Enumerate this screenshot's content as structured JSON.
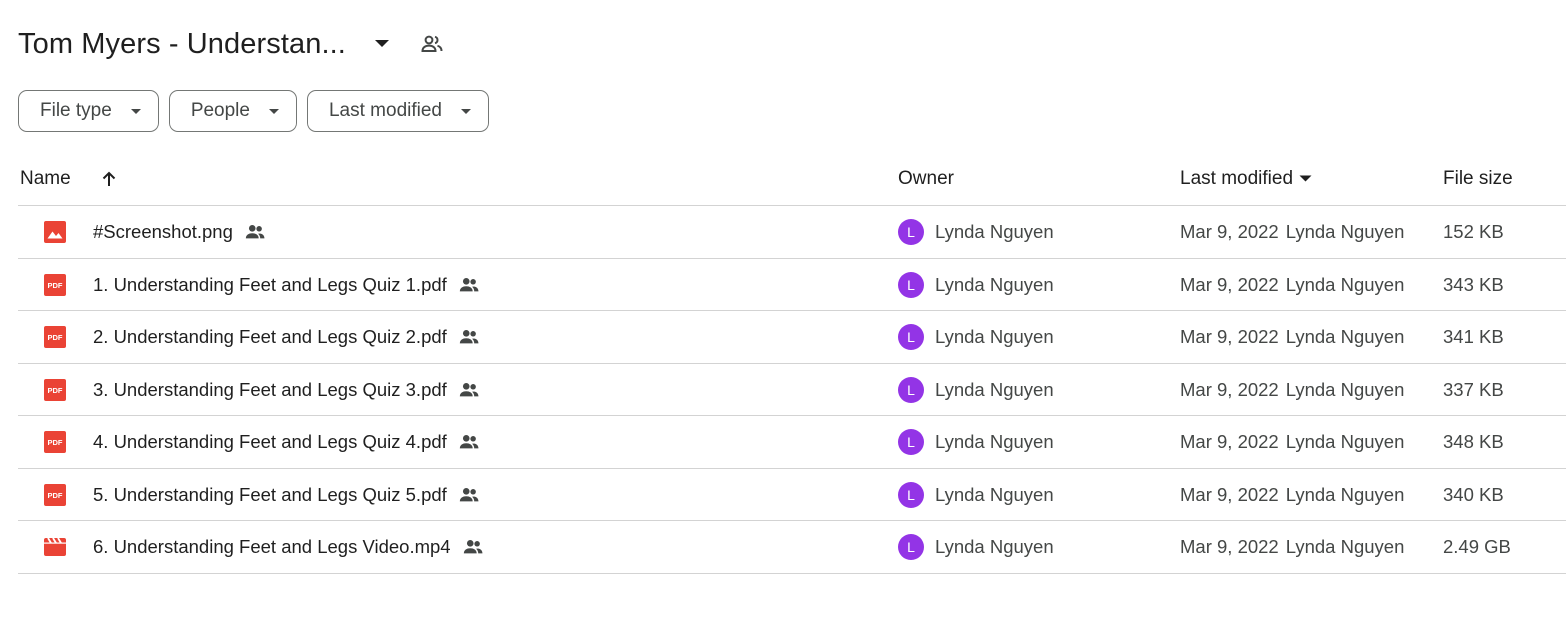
{
  "header": {
    "folder_title": "Tom Myers - Understan..."
  },
  "filters": [
    {
      "label": "File type"
    },
    {
      "label": "People"
    },
    {
      "label": "Last modified"
    }
  ],
  "columns": {
    "name": "Name",
    "owner": "Owner",
    "last_modified": "Last modified",
    "file_size": "File size"
  },
  "files": [
    {
      "name": "#Screenshot.png",
      "type": "image",
      "owner": "Lynda Nguyen",
      "owner_initial": "L",
      "modified_date": "Mar 9, 2022",
      "modified_by": "Lynda Nguyen",
      "size": "152 KB"
    },
    {
      "name": "1. Understanding Feet and Legs Quiz 1.pdf",
      "type": "pdf",
      "owner": "Lynda Nguyen",
      "owner_initial": "L",
      "modified_date": "Mar 9, 2022",
      "modified_by": "Lynda Nguyen",
      "size": "343 KB"
    },
    {
      "name": "2. Understanding Feet and Legs Quiz 2.pdf",
      "type": "pdf",
      "owner": "Lynda Nguyen",
      "owner_initial": "L",
      "modified_date": "Mar 9, 2022",
      "modified_by": "Lynda Nguyen",
      "size": "341 KB"
    },
    {
      "name": "3. Understanding Feet and Legs Quiz 3.pdf",
      "type": "pdf",
      "owner": "Lynda Nguyen",
      "owner_initial": "L",
      "modified_date": "Mar 9, 2022",
      "modified_by": "Lynda Nguyen",
      "size": "337 KB"
    },
    {
      "name": "4. Understanding Feet and Legs Quiz 4.pdf",
      "type": "pdf",
      "owner": "Lynda Nguyen",
      "owner_initial": "L",
      "modified_date": "Mar 9, 2022",
      "modified_by": "Lynda Nguyen",
      "size": "348 KB"
    },
    {
      "name": "5. Understanding Feet and Legs Quiz 5.pdf",
      "type": "pdf",
      "owner": "Lynda Nguyen",
      "owner_initial": "L",
      "modified_date": "Mar 9, 2022",
      "modified_by": "Lynda Nguyen",
      "size": "340 KB"
    },
    {
      "name": "6. Understanding Feet and Legs Video.mp4",
      "type": "video",
      "owner": "Lynda Nguyen",
      "owner_initial": "L",
      "modified_date": "Mar 9, 2022",
      "modified_by": "Lynda Nguyen",
      "size": "2.49 GB"
    }
  ],
  "icons": {
    "image": "image-file-icon",
    "pdf": "pdf-file-icon",
    "video": "video-file-icon",
    "shared": "shared-people-icon"
  },
  "pdf_badge_text": "PDF",
  "colors": {
    "file_icon_red": "#ea4335",
    "avatar_purple": "#9334e6"
  }
}
